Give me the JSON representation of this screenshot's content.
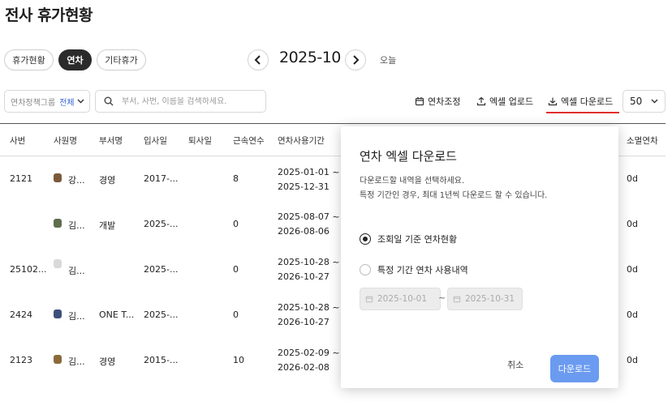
{
  "page": {
    "title": "전사 휴가현황"
  },
  "tabs": [
    {
      "label": "휴가현황",
      "active": false
    },
    {
      "label": "연차",
      "active": true
    },
    {
      "label": "기타휴가",
      "active": false
    }
  ],
  "period": {
    "month": "2025-10",
    "today_label": "오늘"
  },
  "filters": {
    "policy_label": "연차정책그룹",
    "policy_value": "전체",
    "search_placeholder": "부서, 사번, 이름을 검색하세요."
  },
  "toolbar": {
    "adjust_label": "연차조정",
    "upload_label": "엑셀 업로드",
    "download_label": "엑셀 다운로드",
    "page_size": "50"
  },
  "table": {
    "headers": [
      "사번",
      "사원명",
      "부서명",
      "입사일",
      "퇴사일",
      "근속연수",
      "연차사용기간",
      "소멸연차"
    ],
    "rows": [
      {
        "emp_no": "2121",
        "name": "강...",
        "dept": "경영",
        "join": "2017-...",
        "leave": "",
        "years": "8",
        "period_start": "2025-01-01 ~",
        "period_end": "2025-12-31",
        "expired": "0d"
      },
      {
        "emp_no": "",
        "name": "김...",
        "dept": "개발",
        "join": "2025-...",
        "leave": "",
        "years": "0",
        "period_start": "2025-08-07 ~",
        "period_end": "2026-08-06",
        "expired": "0d"
      },
      {
        "emp_no": "25102...",
        "name": "김...",
        "dept": "",
        "join": "2025-...",
        "leave": "",
        "years": "0",
        "period_start": "2025-10-28 ~",
        "period_end": "2026-10-27",
        "expired": "0d"
      },
      {
        "emp_no": "2424",
        "name": "김...",
        "dept": "ONE T...",
        "join": "2025-...",
        "leave": "",
        "years": "0",
        "period_start": "2025-10-28 ~",
        "period_end": "2026-10-27",
        "expired": "0d"
      },
      {
        "emp_no": "2123",
        "name": "김...",
        "dept": "경영",
        "join": "2015-...",
        "leave": "",
        "years": "10",
        "period_start": "2025-02-09 ~",
        "period_end": "2026-02-08",
        "expired": "0d"
      }
    ]
  },
  "dialog": {
    "title": "연차 엑셀 다운로드",
    "desc_line1": "다운로드할 내역을 선택하세요.",
    "desc_line2": "특정 기간인 경우, 최대 1년씩 다운로드 할 수 있습니다.",
    "option1": "조회일 기준 연차현황",
    "option2": "특정 기간 연차 사용내역",
    "date_from": "2025-10-01",
    "date_sep": "~",
    "date_to": "2025-10-31",
    "cancel_label": "취소",
    "download_label": "다운로드"
  },
  "colors": {
    "accent": "#6b9bf0",
    "underline": "#e0302d",
    "active_tab": "#2b2b2b"
  }
}
